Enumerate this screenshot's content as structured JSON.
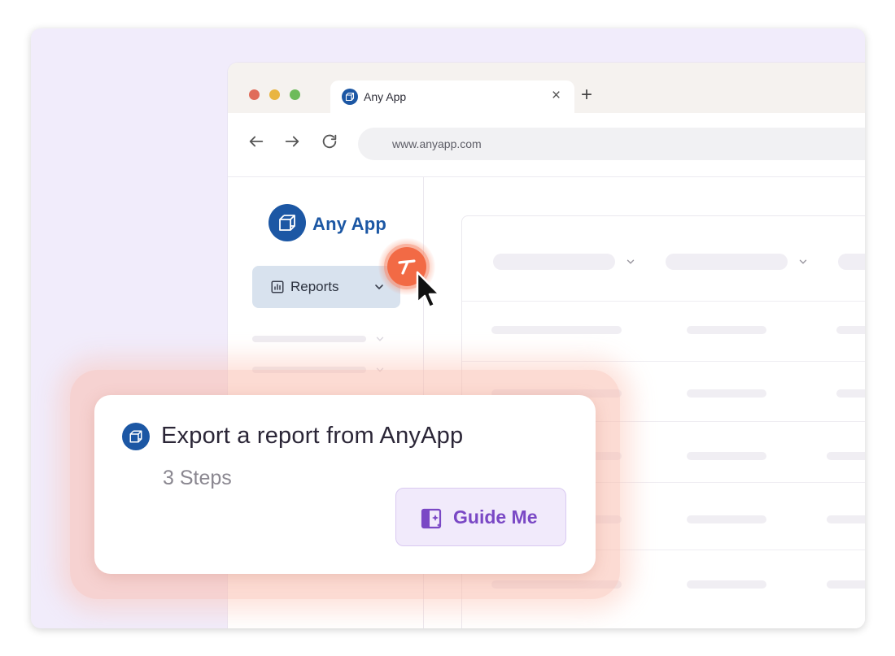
{
  "browser": {
    "tab_title": "Any App",
    "tab_close": "×",
    "new_tab": "+",
    "url": "www.anyapp.com"
  },
  "app": {
    "name": "Any App",
    "nav_selected": "Reports",
    "brand_color": "#1c57a4"
  },
  "guide_card": {
    "title": "Export a report from AnyApp",
    "steps": "3 Steps",
    "button_label": "Guide Me",
    "accent": "#7a48c5"
  },
  "badge": {
    "color": "#f26a45"
  },
  "icons": [
    "cube-icon",
    "back-arrow-icon",
    "forward-arrow-icon",
    "reload-icon",
    "bar-chart-icon",
    "chevron-down-icon",
    "cursor-icon",
    "guide-sparkle-icon"
  ]
}
